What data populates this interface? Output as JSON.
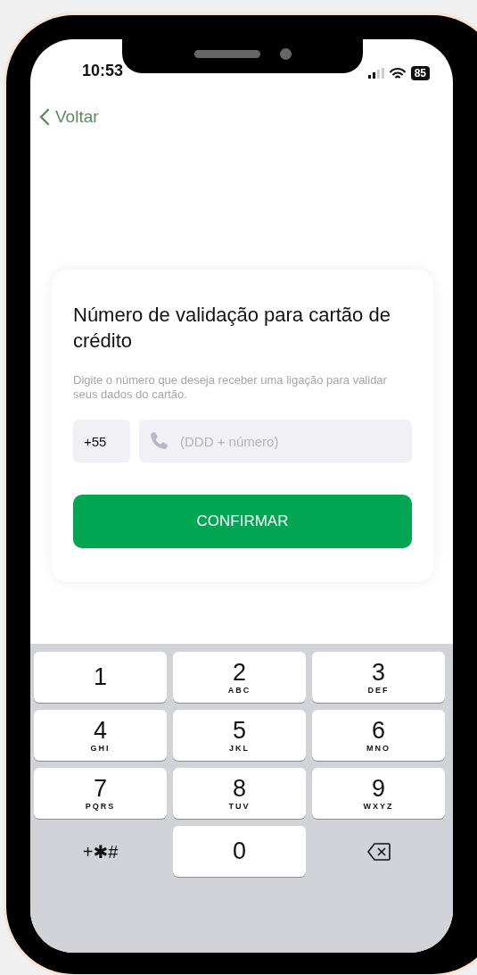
{
  "status_bar": {
    "time": "10:53",
    "battery": "85"
  },
  "nav": {
    "back_label": "Voltar"
  },
  "card": {
    "title": "Número de validação para cartão de crédito",
    "description": "Digite o número que deseja receber uma ligação para validar seus dados do cartão.",
    "country_code": "+55",
    "phone_placeholder": "(DDD + número)",
    "confirm_label": "CONFIRMAR"
  },
  "keypad": [
    {
      "kind": "digit",
      "digit": "1"
    },
    {
      "kind": "digit",
      "digit": "2",
      "letters": "ABC"
    },
    {
      "kind": "digit",
      "digit": "3",
      "letters": "DEF"
    },
    {
      "kind": "digit",
      "digit": "4",
      "letters": "GHI"
    },
    {
      "kind": "digit",
      "digit": "5",
      "letters": "JKL"
    },
    {
      "kind": "digit",
      "digit": "6",
      "letters": "MNO"
    },
    {
      "kind": "digit",
      "digit": "7",
      "letters": "PQRS"
    },
    {
      "kind": "digit",
      "digit": "8",
      "letters": "TUV"
    },
    {
      "kind": "digit",
      "digit": "9",
      "letters": "WXYZ"
    },
    {
      "kind": "symbols",
      "digit": "+✱#"
    },
    {
      "kind": "digit",
      "digit": "0"
    },
    {
      "kind": "delete"
    }
  ]
}
